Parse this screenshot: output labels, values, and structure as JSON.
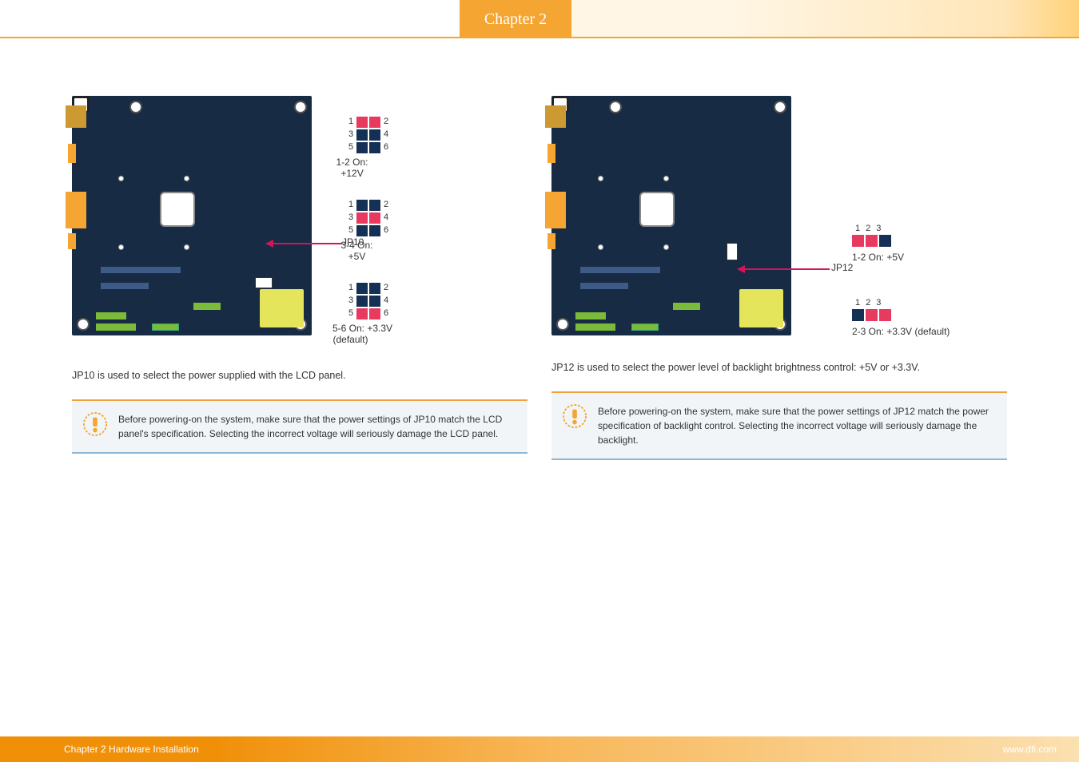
{
  "header": {
    "chapter_tab": "Chapter 2"
  },
  "left": {
    "jumper_name": "JP10",
    "options": [
      {
        "label": "1-2 On: +12V",
        "on_cells": [
          0,
          1
        ]
      },
      {
        "label": "3-4 On: +5V",
        "on_cells": [
          2,
          3
        ]
      },
      {
        "label": "5-6 On: +3.3V\n(default)",
        "on_cells": [
          4,
          5
        ]
      }
    ],
    "pins6": {
      "left": [
        "1",
        "3",
        "5"
      ],
      "right": [
        "2",
        "4",
        "6"
      ]
    },
    "desc": "JP10 is used to select the power supplied with the LCD panel.",
    "note": "Before powering-on the system, make sure that the power settings of JP10 match the LCD panel's specification. Selecting the incorrect voltage will seriously damage the LCD panel."
  },
  "right": {
    "jumper_name": "JP12",
    "options": [
      {
        "label": "1-2 On: +5V",
        "on_cells": [
          0,
          1
        ]
      },
      {
        "label": "2-3 On: +3.3V (default)",
        "on_cells": [
          1,
          2
        ]
      }
    ],
    "pins3": [
      "1",
      "2",
      "3"
    ],
    "desc": "JP12 is used to select the power level of backlight brightness control: +5V or +3.3V.",
    "note": "Before powering-on the system, make sure that the power settings of JP12 match the power specification of backlight control. Selecting the incorrect voltage will seriously damage the backlight."
  },
  "footer": {
    "left": "Chapter 2 Hardware Installation",
    "right": "www.dfi.com"
  }
}
